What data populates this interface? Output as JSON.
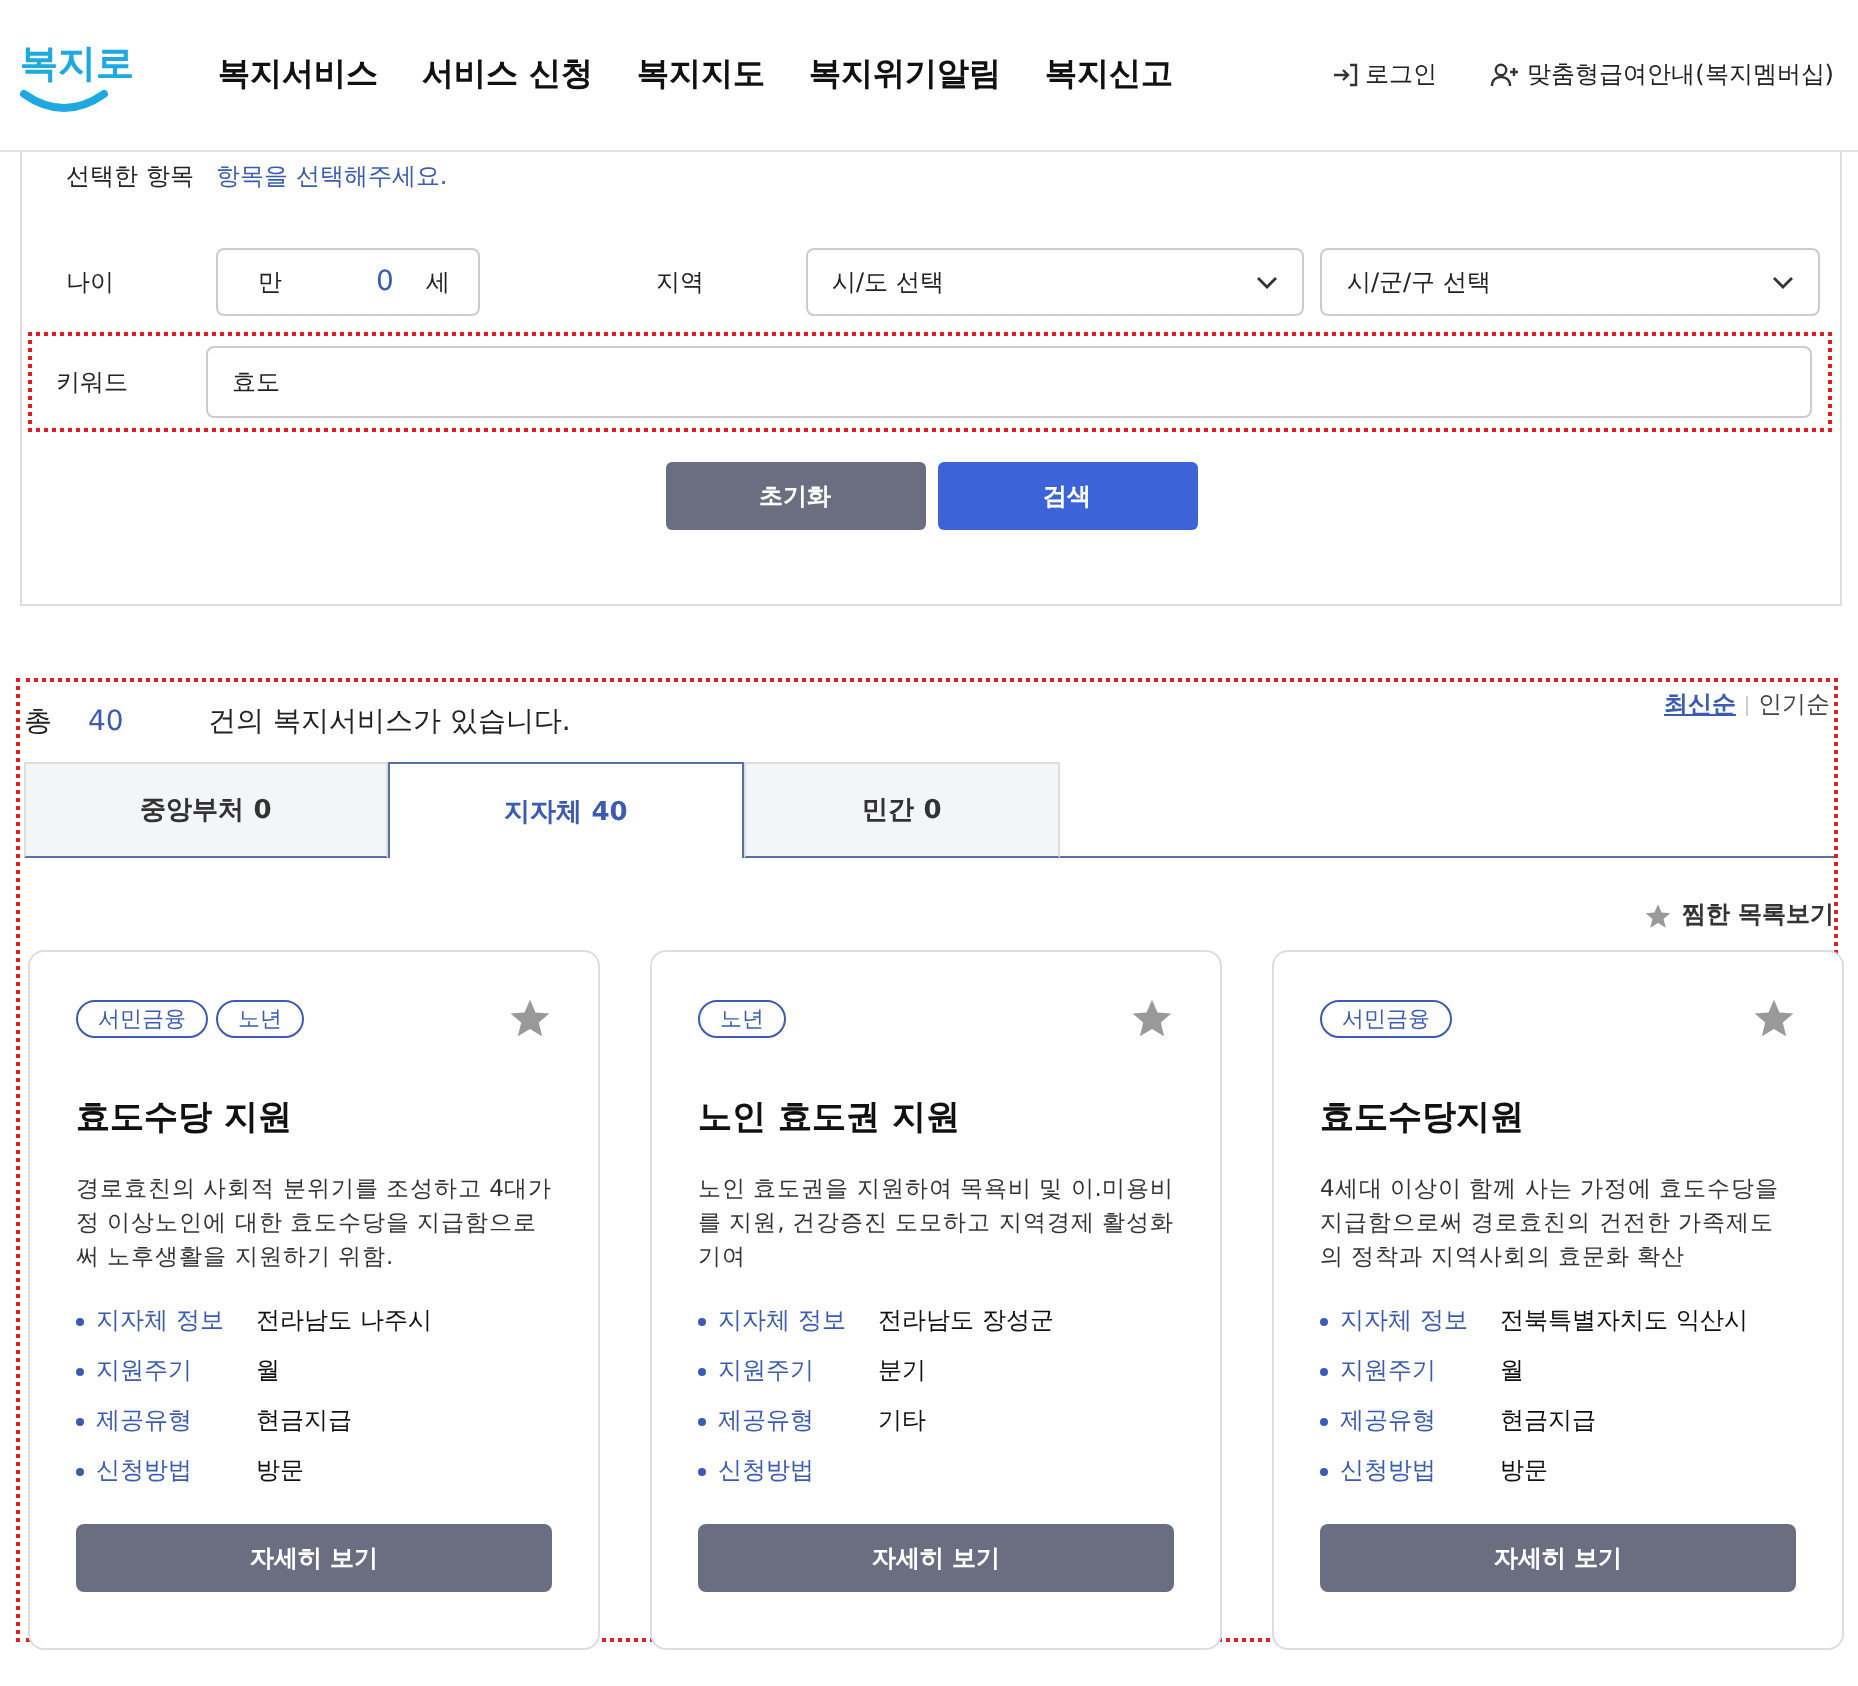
{
  "header": {
    "logo": "복지로",
    "nav": [
      "복지서비스",
      "서비스 신청",
      "복지지도",
      "복지위기알림",
      "복지신고"
    ],
    "login": "로그인",
    "membership": "맞춤형급여안내(복지멤버십)"
  },
  "filter": {
    "selected_label": "선택한 항목",
    "selected_hint": "항목을 선택해주세요.",
    "age_label": "나이",
    "age_prefix": "만",
    "age_value": "0",
    "age_suffix": "세",
    "region_label": "지역",
    "province_placeholder": "시/도 선택",
    "city_placeholder": "시/군/구 선택",
    "keyword_label": "키워드",
    "keyword_value": "효도",
    "reset": "초기화",
    "search": "검색"
  },
  "results": {
    "total_prefix": "총",
    "total_count": "40",
    "total_suffix": "건의 복지서비스가 있습니다.",
    "sort": [
      {
        "label": "최신순",
        "selected": true
      },
      {
        "label": "인기순",
        "selected": false
      }
    ],
    "tabs": [
      {
        "label": "중앙부처",
        "count": "0",
        "selected": false
      },
      {
        "label": "지자체",
        "count": "40",
        "selected": true
      },
      {
        "label": "민간",
        "count": "0",
        "selected": false
      }
    ],
    "favorites": "찜한 목록보기",
    "cards": [
      {
        "tags": [
          "서민금융",
          "노년"
        ],
        "title": "효도수당 지원",
        "description": "경로효친의 사회적 분위기를 조성하고 4대가정 이상노인에 대한 효도수당을 지급함으로써 노후생활을 지원하기 위함.",
        "info": [
          {
            "label": "지자체 정보",
            "value": "전라남도 나주시"
          },
          {
            "label": "지원주기",
            "value": "월"
          },
          {
            "label": "제공유형",
            "value": "현금지급"
          },
          {
            "label": "신청방법",
            "value": "방문"
          }
        ],
        "button": "자세히 보기"
      },
      {
        "tags": [
          "노년"
        ],
        "title": "노인 효도권 지원",
        "description": "노인 효도권을 지원하여 목욕비 및 이.미용비를 지원, 건강증진 도모하고 지역경제 활성화 기여",
        "info": [
          {
            "label": "지자체 정보",
            "value": "전라남도 장성군"
          },
          {
            "label": "지원주기",
            "value": "분기"
          },
          {
            "label": "제공유형",
            "value": "기타"
          },
          {
            "label": "신청방법"
          }
        ],
        "button": "자세히 보기"
      },
      {
        "tags": [
          "서민금융"
        ],
        "title": "효도수당지원",
        "description": "4세대 이상이 함께 사는 가정에 효도수당을 지급함으로써 경로효친의 건전한 가족제도의 정착과 지역사회의 효문화 확산",
        "info": [
          {
            "label": "지자체 정보",
            "value": "전북특별자치도 익산시"
          },
          {
            "label": "지원주기",
            "value": "월"
          },
          {
            "label": "제공유형",
            "value": "현금지급"
          },
          {
            "label": "신청방법",
            "value": "방문"
          }
        ],
        "button": "자세히 보기"
      }
    ]
  }
}
